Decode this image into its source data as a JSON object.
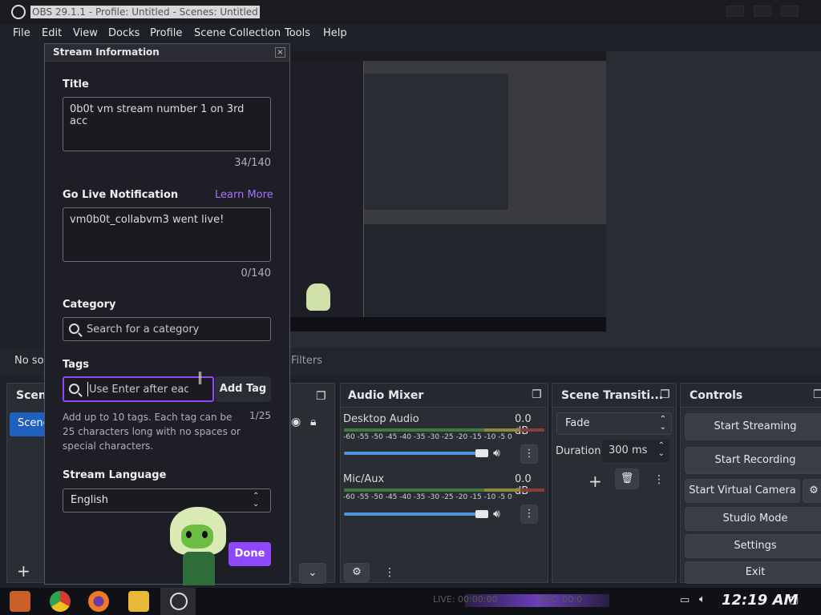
{
  "window": {
    "title": "OBS 29.1.1 - Profile: Untitled - Scenes: Untitled"
  },
  "menu": [
    "File",
    "Edit",
    "View",
    "Docks",
    "Profile",
    "Scene Collection",
    "Tools",
    "Help"
  ],
  "dialog": {
    "title": "Stream Information",
    "title_label": "Title",
    "title_value": "0b0t vm stream number 1 on 3rd acc",
    "title_count": "34/140",
    "notif_label": "Go Live Notification",
    "learn_more": "Learn More",
    "notif_value": "vm0b0t_collabvm3 went live!",
    "notif_count": "0/140",
    "category_label": "Category",
    "category_placeholder": "Search for a category",
    "tags_label": "Tags",
    "tags_placeholder": "Use Enter after each",
    "add_tag": "Add Tag",
    "tags_help": "Add up to 10 tags. Each tag can be 25 characters long with no spaces or special characters.",
    "tags_count": "1/25",
    "language_label": "Stream Language",
    "language_value": "English",
    "done": "Done"
  },
  "behind": {
    "no_source": "No so",
    "filters": "Filters",
    "scenes_title": "Scen",
    "scene_item": "Scene"
  },
  "audio_mixer": {
    "title": "Audio Mixer",
    "ticks": "-60 -55 -50 -45 -40 -35 -30 -25 -20 -15 -10 -5 0",
    "channels": [
      {
        "name": "Desktop Audio",
        "db": "0.0 dB",
        "level": 0.98
      },
      {
        "name": "Mic/Aux",
        "db": "0.0 dB",
        "level": 0.98
      }
    ]
  },
  "transitions": {
    "title": "Scene Transiti...",
    "transition": "Fade",
    "duration_label": "Duration",
    "duration_value": "300 ms"
  },
  "controls": {
    "title": "Controls",
    "buttons": [
      "Start Streaming",
      "Start Recording",
      "Start Virtual Camera",
      "Studio Mode",
      "Settings",
      "Exit"
    ]
  },
  "status": {
    "live": "LIVE: 00:00:00",
    "rec": "REC: 00:0"
  },
  "taskbar": {
    "clock": "12:19 AM"
  },
  "colors": {
    "accent": "#9147ff",
    "blue": "#4e95dc"
  }
}
